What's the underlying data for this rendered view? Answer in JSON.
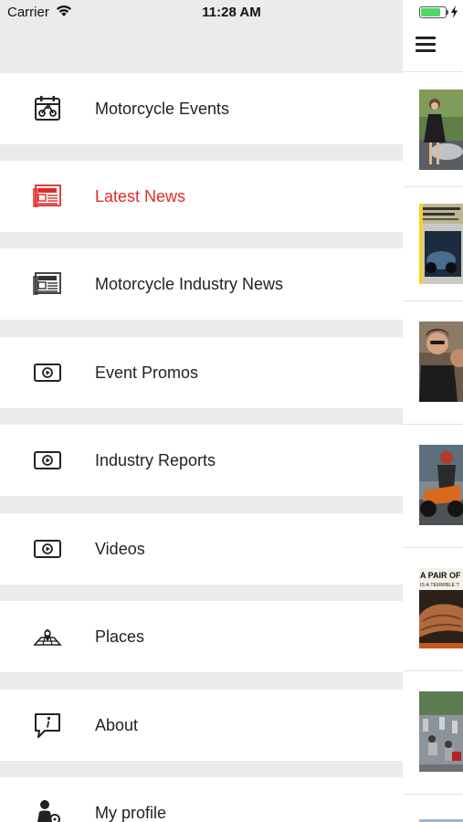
{
  "status_bar": {
    "carrier": "Carrier",
    "time": "11:28 AM",
    "battery_level": 0.85
  },
  "drawer": {
    "items": [
      {
        "label": "Motorcycle Events",
        "icon": "motorcycle-calendar-icon",
        "active": false
      },
      {
        "label": "Latest News",
        "icon": "newspaper-icon",
        "active": true
      },
      {
        "label": "Motorcycle Industry News",
        "icon": "newspaper-icon",
        "active": false
      },
      {
        "label": "Event Promos",
        "icon": "video-play-icon",
        "active": false
      },
      {
        "label": "Industry Reports",
        "icon": "video-play-icon",
        "active": false
      },
      {
        "label": "Videos",
        "icon": "video-play-icon",
        "active": false
      },
      {
        "label": "Places",
        "icon": "map-pin-icon",
        "active": false
      },
      {
        "label": "About",
        "icon": "info-bubble-icon",
        "active": false
      },
      {
        "label": "My profile",
        "icon": "rider-profile-icon",
        "active": false
      }
    ]
  },
  "content": {
    "menu_icon": "hamburger-menu-icon",
    "article_thumbnails": [
      {
        "icon": "thumbnail-woman-motorcycle"
      },
      {
        "icon": "thumbnail-magazine-cover"
      },
      {
        "icon": "thumbnail-couple"
      },
      {
        "icon": "thumbnail-rider-orange-bike"
      },
      {
        "icon": "thumbnail-a-pair-of-hands",
        "caption": "A PAIR OF",
        "caption2": "IS A TERRIBLE T"
      },
      {
        "icon": "thumbnail-parade-riders"
      },
      {
        "icon": "thumbnail-partial"
      }
    ]
  },
  "colors": {
    "accent_active": "#e12b2b",
    "background": "#ebebeb",
    "item_background": "#ffffff"
  }
}
